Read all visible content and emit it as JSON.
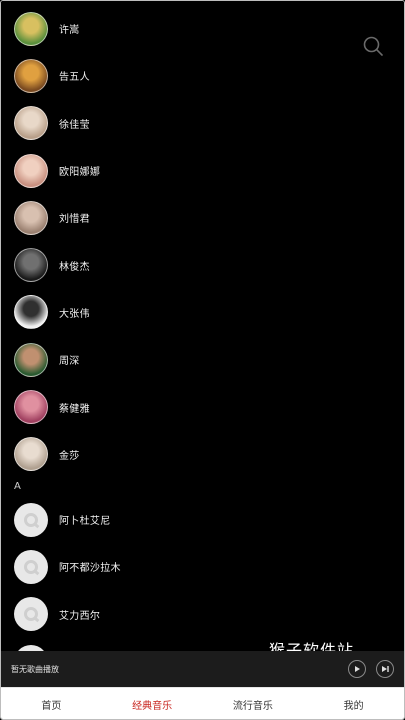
{
  "artists_prev_section": [
    {
      "name": "许嵩",
      "avatar_colors": [
        "#5a8f3c",
        "#d8c060"
      ]
    },
    {
      "name": "告五人",
      "avatar_colors": [
        "#7a4a20",
        "#e0a040"
      ]
    },
    {
      "name": "徐佳莹",
      "avatar_colors": [
        "#b9a08a",
        "#e8d8c8"
      ]
    },
    {
      "name": "欧阳娜娜",
      "avatar_colors": [
        "#c89080",
        "#f0d0c0"
      ]
    },
    {
      "name": "刘惜君",
      "avatar_colors": [
        "#9a8070",
        "#d8c0b0"
      ]
    },
    {
      "name": "林俊杰",
      "avatar_colors": [
        "#1a1a1a",
        "#707070"
      ]
    },
    {
      "name": "大张伟",
      "avatar_colors": [
        "#f0f0f0",
        "#303030"
      ]
    },
    {
      "name": "周深",
      "avatar_colors": [
        "#2a5a30",
        "#c09070"
      ]
    },
    {
      "name": "蔡健雅",
      "avatar_colors": [
        "#a04060",
        "#e090a0"
      ]
    },
    {
      "name": "金莎",
      "avatar_colors": [
        "#b0a090",
        "#e8dcd0"
      ]
    }
  ],
  "section_a": {
    "letter": "A",
    "artists": [
      {
        "name": "阿卜杜艾尼"
      },
      {
        "name": "阿不都沙拉木"
      },
      {
        "name": "艾力西尔"
      }
    ]
  },
  "watermark": "猴子软件站",
  "player": {
    "status": "暂无歌曲播放",
    "play_icon": "play-icon",
    "next_icon": "next-track-icon"
  },
  "tabs": [
    {
      "label": "首页",
      "active": false
    },
    {
      "label": "经典音乐",
      "active": true
    },
    {
      "label": "流行音乐",
      "active": false
    },
    {
      "label": "我的",
      "active": false
    }
  ],
  "colors": {
    "accent": "#c8251f",
    "background": "#000000",
    "player_bg": "#1c1c1c"
  }
}
